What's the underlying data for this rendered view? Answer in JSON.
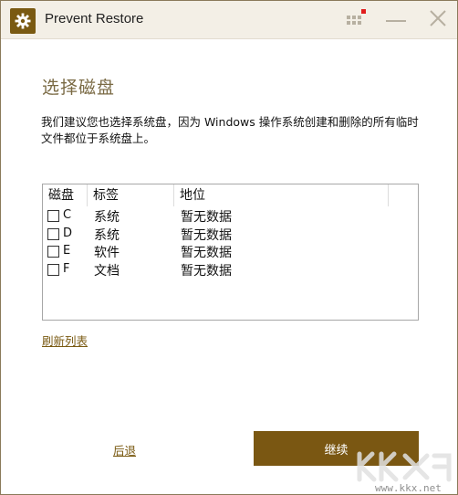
{
  "window": {
    "title": "Prevent Restore"
  },
  "heading": "选择磁盘",
  "description": "我们建议您也选择系统盘，因为 Windows 操作系统创建和删除的所有临时文件都位于系统盘上。",
  "table": {
    "columns": [
      "磁盘",
      "标签",
      "地位"
    ],
    "rows": [
      {
        "drive": "C",
        "label": "系统",
        "status": "暂无数据",
        "checked": false
      },
      {
        "drive": "D",
        "label": "系统",
        "status": "暂无数据",
        "checked": false
      },
      {
        "drive": "E",
        "label": "软件",
        "status": "暂无数据",
        "checked": false
      },
      {
        "drive": "F",
        "label": "文档",
        "status": "暂无数据",
        "checked": false
      }
    ]
  },
  "links": {
    "refresh": "刷新列表",
    "back": "后退"
  },
  "buttons": {
    "continue": "继续"
  },
  "watermark": {
    "url": "www.kkx.net"
  },
  "colors": {
    "accent": "#7a5712",
    "heading": "#7a6a44",
    "titlebar": "#f3efe6",
    "indicator": "#e11d1d"
  }
}
